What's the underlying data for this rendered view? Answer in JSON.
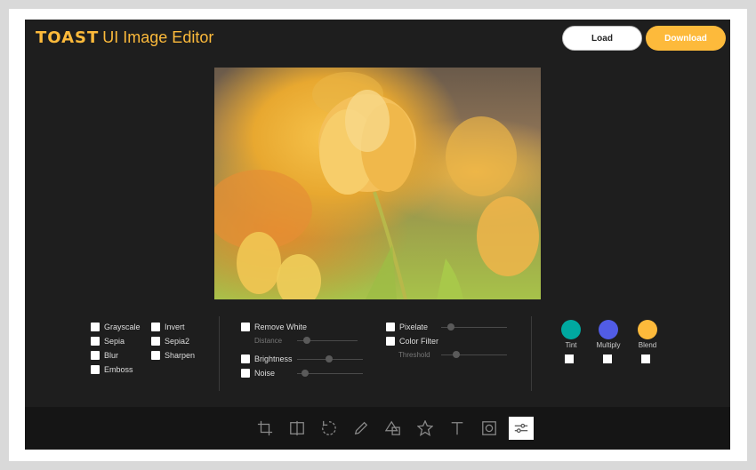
{
  "header": {
    "brand": "TOAST",
    "title": "UI Image Editor",
    "load_label": "Load",
    "download_label": "Download"
  },
  "colors": {
    "accent": "#fdba3b",
    "tint": "#00a9a0",
    "multiply": "#515ce6",
    "blend": "#fdba3b",
    "background": "#1e1e1e"
  },
  "filters": {
    "col1": [
      "Grayscale",
      "Sepia",
      "Blur",
      "Emboss"
    ],
    "col2": [
      "Invert",
      "Sepia2",
      "Sharpen"
    ],
    "remove_white": "Remove White",
    "distance": "Distance",
    "brightness": "Brightness",
    "noise": "Noise",
    "pixelate": "Pixelate",
    "color_filter": "Color Filter",
    "threshold": "Threshold"
  },
  "colors_panel": {
    "tint": "Tint",
    "multiply": "Multiply",
    "blend": "Blend"
  },
  "toolbar": {
    "icons": [
      "crop-icon",
      "flip-icon",
      "rotate-icon",
      "draw-icon",
      "shape-icon",
      "icon-icon",
      "text-icon",
      "mask-icon",
      "filter-icon"
    ],
    "active": "filter-icon"
  }
}
